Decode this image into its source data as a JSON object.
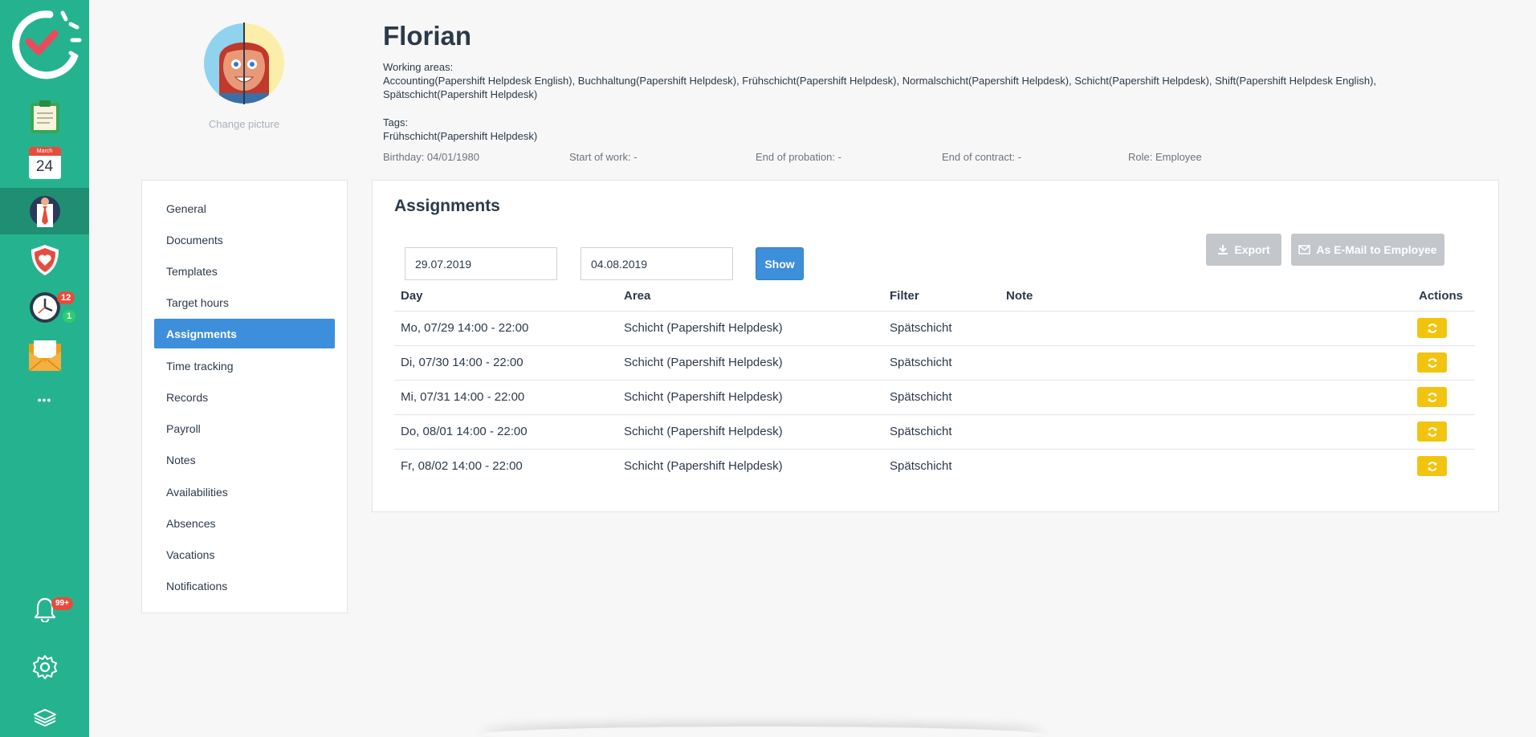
{
  "rail": {
    "calendar_month": "March",
    "calendar_day": "24",
    "clock_badge_red": "12",
    "clock_badge_green": "1",
    "more_glyph": "•••",
    "notif_badge": "99+",
    "colors": {
      "background": "#25b38f",
      "active": "#1f8e72"
    }
  },
  "profile": {
    "name": "Florian",
    "change_picture": "Change picture",
    "working_areas_label": "Working areas:",
    "working_areas_value": "Accounting(Papershift Helpdesk English), Buchhaltung(Papershift Helpdesk), Frühschicht(Papershift Helpdesk), Normalschicht(Papershift Helpdesk), Schicht(Papershift Helpdesk), Shift(Papershift Helpdesk English), Spätschicht(Papershift Helpdesk)",
    "tags_label": "Tags:",
    "tags_value": "Frühschicht(Papershift Helpdesk)",
    "meta": {
      "birthday": "Birthday: 04/01/1980",
      "start_of_work": "Start of work: -",
      "end_of_probation": "End of probation: -",
      "end_of_contract": "End of contract: -",
      "role": "Role: Employee"
    }
  },
  "menu": {
    "items": [
      {
        "label": "General"
      },
      {
        "label": "Documents"
      },
      {
        "label": "Templates"
      },
      {
        "label": "Target hours"
      },
      {
        "label": "Assignments"
      },
      {
        "label": "Time tracking"
      },
      {
        "label": "Records"
      },
      {
        "label": "Payroll"
      },
      {
        "label": "Notes"
      },
      {
        "label": "Availabilities"
      },
      {
        "label": "Absences"
      },
      {
        "label": "Vacations"
      },
      {
        "label": "Notifications"
      }
    ],
    "active": "Assignments"
  },
  "assignments": {
    "title": "Assignments",
    "from_date": "29.07.2019",
    "to_date": "04.08.2019",
    "show_label": "Show",
    "export_label": "Export",
    "email_label": "As E-Mail to Employee",
    "columns": {
      "day": "Day",
      "area": "Area",
      "filter": "Filter",
      "note": "Note",
      "actions": "Actions"
    },
    "rows": [
      {
        "day": "Mo, 07/29 14:00 - 22:00",
        "area": "Schicht (Papershift Helpdesk)",
        "filter": "Spätschicht",
        "note": ""
      },
      {
        "day": "Di, 07/30 14:00 - 22:00",
        "area": "Schicht (Papershift Helpdesk)",
        "filter": "Spätschicht",
        "note": ""
      },
      {
        "day": "Mi, 07/31 14:00 - 22:00",
        "area": "Schicht (Papershift Helpdesk)",
        "filter": "Spätschicht",
        "note": ""
      },
      {
        "day": "Do, 08/01 14:00 - 22:00",
        "area": "Schicht (Papershift Helpdesk)",
        "filter": "Spätschicht",
        "note": ""
      },
      {
        "day": "Fr, 08/02 14:00 - 22:00",
        "area": "Schicht (Papershift Helpdesk)",
        "filter": "Spätschicht",
        "note": ""
      }
    ],
    "colors": {
      "primary": "#3d8fdb",
      "swap": "#f1c40f",
      "disabled": "#c3c7cb"
    }
  }
}
